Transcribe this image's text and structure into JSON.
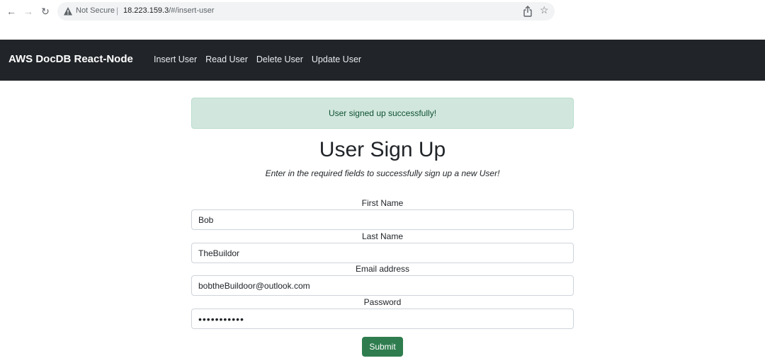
{
  "browser": {
    "security_label": "Not Secure",
    "separator": "|",
    "url_host": "18.223.159.3",
    "url_path": "/#/insert-user"
  },
  "navbar": {
    "brand": "AWS DocDB React-Node",
    "links": [
      {
        "label": "Insert User"
      },
      {
        "label": "Read User"
      },
      {
        "label": "Delete User"
      },
      {
        "label": "Update User"
      }
    ]
  },
  "alert": {
    "message": "User signed up successfully!"
  },
  "form": {
    "title": "User Sign Up",
    "subtitle": "Enter in the required fields to successfully sign up a new User!",
    "fields": [
      {
        "label": "First Name",
        "value": "Bob"
      },
      {
        "label": "Last Name",
        "value": "TheBuildor"
      },
      {
        "label": "Email address",
        "value": "bobtheBuildoor@outlook.com"
      },
      {
        "label": "Password",
        "value": "•••••••••••"
      }
    ],
    "submit_label": "Submit"
  },
  "colors": {
    "navbar_bg": "#212529",
    "alert_bg": "#d1e7dd",
    "alert_text": "#0f5132",
    "submit_bg": "#2f7d4e"
  }
}
